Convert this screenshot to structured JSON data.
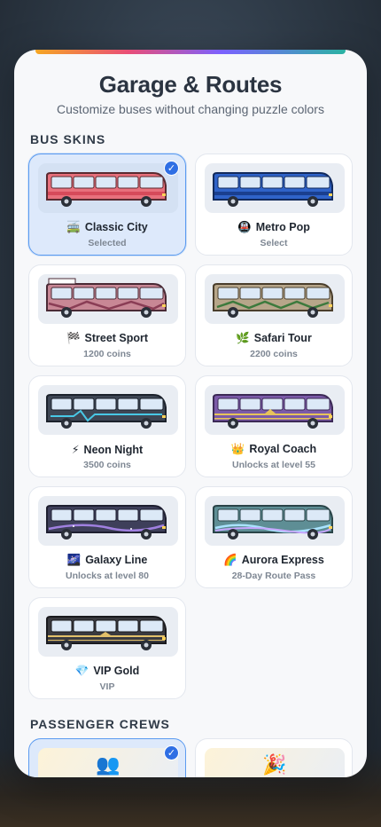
{
  "header": {
    "title": "Garage & Routes",
    "subtitle": "Customize buses without changing puzzle colors"
  },
  "sections": {
    "bus_skins": "BUS SKINS",
    "passenger_crews": "PASSENGER CREWS"
  },
  "skins": [
    {
      "icon": "🚎",
      "name": "Classic City",
      "status": "Selected",
      "selected": true,
      "body": "#e8707c",
      "roof": "#f4a0a8",
      "stripe": "#d64a5a",
      "outline": "#5a2a30",
      "shape": "classic"
    },
    {
      "icon": "🚇",
      "name": "Metro Pop",
      "status": "Select",
      "selected": false,
      "body": "#2f63c9",
      "roof": "#5b8ae0",
      "stripe": "#1a3f8f",
      "outline": "#122a5c",
      "shape": "classic"
    },
    {
      "icon": "🏁",
      "name": "Street Sport",
      "status": "1200 coins",
      "selected": false,
      "body": "#c88795",
      "roof": "#ffffff",
      "stripe": "#8a3d55",
      "outline": "#4a2a35",
      "shape": "sport"
    },
    {
      "icon": "🌿",
      "name": "Safari Tour",
      "status": "2200 coins",
      "selected": false,
      "body": "#b7a68a",
      "roof": "#cdbd9f",
      "stripe": "#3d7a3d",
      "outline": "#4a3e2c",
      "shape": "zigzag"
    },
    {
      "icon": "⚡",
      "name": "Neon Night",
      "status": "3500 coins",
      "selected": false,
      "body": "#3e4654",
      "roof": "#525c6c",
      "stripe": "#48c8e6",
      "outline": "#1c222c",
      "shape": "neon"
    },
    {
      "icon": "👑",
      "name": "Royal Coach",
      "status": "Unlocks at level 55",
      "selected": false,
      "body": "#7b5aa8",
      "roof": "#9679c0",
      "stripe": "#e7c35a",
      "outline": "#3c2a56",
      "shape": "royal"
    },
    {
      "icon": "🌌",
      "name": "Galaxy Line",
      "status": "Unlocks at level 80",
      "selected": false,
      "body": "#3e3f5a",
      "roof": "#54557a",
      "stripe": "#a080e0",
      "outline": "#1e1f30",
      "shape": "galaxy"
    },
    {
      "icon": "🌈",
      "name": "Aurora Express",
      "status": "28-Day Route Pass",
      "selected": false,
      "body": "#5e8e95",
      "roof": "#78a9ae",
      "stripe": "#a9e3ff",
      "outline": "#2a4448",
      "shape": "aurora"
    },
    {
      "icon": "💎",
      "name": "VIP Gold",
      "status": "VIP",
      "selected": false,
      "body": "#3a3a3f",
      "roof": "#4d4d55",
      "stripe": "#e2c06a",
      "outline": "#1a1a1e",
      "shape": "vip"
    }
  ],
  "crews": [
    {
      "icon": "👥",
      "selected": true
    },
    {
      "icon": "🎉",
      "selected": false
    }
  ],
  "check_glyph": "✓"
}
